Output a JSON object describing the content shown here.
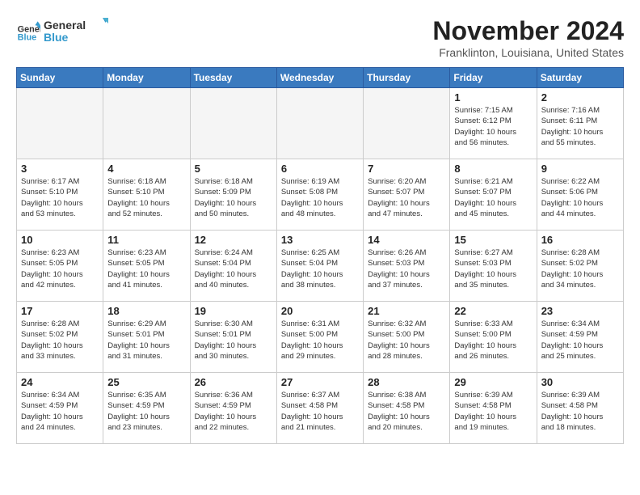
{
  "header": {
    "logo_general": "General",
    "logo_blue": "Blue",
    "month_title": "November 2024",
    "subtitle": "Franklinton, Louisiana, United States"
  },
  "weekdays": [
    "Sunday",
    "Monday",
    "Tuesday",
    "Wednesday",
    "Thursday",
    "Friday",
    "Saturday"
  ],
  "weeks": [
    [
      {
        "day": "",
        "info": ""
      },
      {
        "day": "",
        "info": ""
      },
      {
        "day": "",
        "info": ""
      },
      {
        "day": "",
        "info": ""
      },
      {
        "day": "",
        "info": ""
      },
      {
        "day": "1",
        "info": "Sunrise: 7:15 AM\nSunset: 6:12 PM\nDaylight: 10 hours\nand 56 minutes."
      },
      {
        "day": "2",
        "info": "Sunrise: 7:16 AM\nSunset: 6:11 PM\nDaylight: 10 hours\nand 55 minutes."
      }
    ],
    [
      {
        "day": "3",
        "info": "Sunrise: 6:17 AM\nSunset: 5:10 PM\nDaylight: 10 hours\nand 53 minutes."
      },
      {
        "day": "4",
        "info": "Sunrise: 6:18 AM\nSunset: 5:10 PM\nDaylight: 10 hours\nand 52 minutes."
      },
      {
        "day": "5",
        "info": "Sunrise: 6:18 AM\nSunset: 5:09 PM\nDaylight: 10 hours\nand 50 minutes."
      },
      {
        "day": "6",
        "info": "Sunrise: 6:19 AM\nSunset: 5:08 PM\nDaylight: 10 hours\nand 48 minutes."
      },
      {
        "day": "7",
        "info": "Sunrise: 6:20 AM\nSunset: 5:07 PM\nDaylight: 10 hours\nand 47 minutes."
      },
      {
        "day": "8",
        "info": "Sunrise: 6:21 AM\nSunset: 5:07 PM\nDaylight: 10 hours\nand 45 minutes."
      },
      {
        "day": "9",
        "info": "Sunrise: 6:22 AM\nSunset: 5:06 PM\nDaylight: 10 hours\nand 44 minutes."
      }
    ],
    [
      {
        "day": "10",
        "info": "Sunrise: 6:23 AM\nSunset: 5:05 PM\nDaylight: 10 hours\nand 42 minutes."
      },
      {
        "day": "11",
        "info": "Sunrise: 6:23 AM\nSunset: 5:05 PM\nDaylight: 10 hours\nand 41 minutes."
      },
      {
        "day": "12",
        "info": "Sunrise: 6:24 AM\nSunset: 5:04 PM\nDaylight: 10 hours\nand 40 minutes."
      },
      {
        "day": "13",
        "info": "Sunrise: 6:25 AM\nSunset: 5:04 PM\nDaylight: 10 hours\nand 38 minutes."
      },
      {
        "day": "14",
        "info": "Sunrise: 6:26 AM\nSunset: 5:03 PM\nDaylight: 10 hours\nand 37 minutes."
      },
      {
        "day": "15",
        "info": "Sunrise: 6:27 AM\nSunset: 5:03 PM\nDaylight: 10 hours\nand 35 minutes."
      },
      {
        "day": "16",
        "info": "Sunrise: 6:28 AM\nSunset: 5:02 PM\nDaylight: 10 hours\nand 34 minutes."
      }
    ],
    [
      {
        "day": "17",
        "info": "Sunrise: 6:28 AM\nSunset: 5:02 PM\nDaylight: 10 hours\nand 33 minutes."
      },
      {
        "day": "18",
        "info": "Sunrise: 6:29 AM\nSunset: 5:01 PM\nDaylight: 10 hours\nand 31 minutes."
      },
      {
        "day": "19",
        "info": "Sunrise: 6:30 AM\nSunset: 5:01 PM\nDaylight: 10 hours\nand 30 minutes."
      },
      {
        "day": "20",
        "info": "Sunrise: 6:31 AM\nSunset: 5:00 PM\nDaylight: 10 hours\nand 29 minutes."
      },
      {
        "day": "21",
        "info": "Sunrise: 6:32 AM\nSunset: 5:00 PM\nDaylight: 10 hours\nand 28 minutes."
      },
      {
        "day": "22",
        "info": "Sunrise: 6:33 AM\nSunset: 5:00 PM\nDaylight: 10 hours\nand 26 minutes."
      },
      {
        "day": "23",
        "info": "Sunrise: 6:34 AM\nSunset: 4:59 PM\nDaylight: 10 hours\nand 25 minutes."
      }
    ],
    [
      {
        "day": "24",
        "info": "Sunrise: 6:34 AM\nSunset: 4:59 PM\nDaylight: 10 hours\nand 24 minutes."
      },
      {
        "day": "25",
        "info": "Sunrise: 6:35 AM\nSunset: 4:59 PM\nDaylight: 10 hours\nand 23 minutes."
      },
      {
        "day": "26",
        "info": "Sunrise: 6:36 AM\nSunset: 4:59 PM\nDaylight: 10 hours\nand 22 minutes."
      },
      {
        "day": "27",
        "info": "Sunrise: 6:37 AM\nSunset: 4:58 PM\nDaylight: 10 hours\nand 21 minutes."
      },
      {
        "day": "28",
        "info": "Sunrise: 6:38 AM\nSunset: 4:58 PM\nDaylight: 10 hours\nand 20 minutes."
      },
      {
        "day": "29",
        "info": "Sunrise: 6:39 AM\nSunset: 4:58 PM\nDaylight: 10 hours\nand 19 minutes."
      },
      {
        "day": "30",
        "info": "Sunrise: 6:39 AM\nSunset: 4:58 PM\nDaylight: 10 hours\nand 18 minutes."
      }
    ]
  ]
}
